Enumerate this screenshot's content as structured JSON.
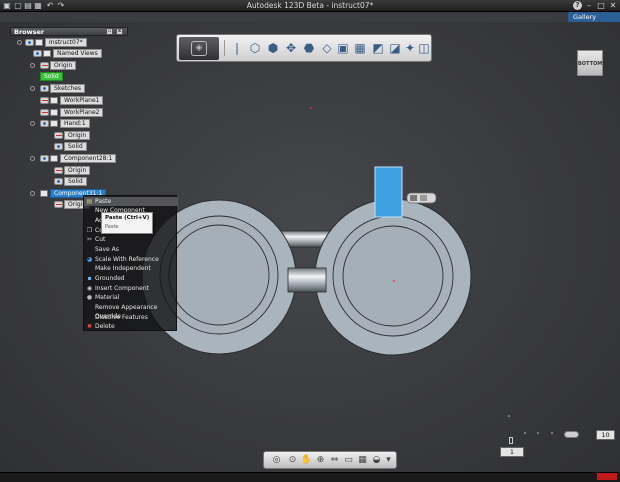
{
  "titlebar": {
    "title": "Autodesk 123D Beta - instruct07*",
    "help": "?",
    "gallery": "Gallery"
  },
  "browser": {
    "header": "Browser",
    "items": [
      {
        "label": "Instruct07*",
        "icon": "document-icon"
      },
      {
        "label": "Named Views",
        "icon": "folder-icon"
      },
      {
        "label": "Origin",
        "icon": "origin-icon"
      },
      {
        "label": "Solid",
        "icon": "solid-icon"
      },
      {
        "label": "Sketches",
        "icon": "folder-icon"
      },
      {
        "label": "WorkPlane1",
        "icon": "workplane-icon"
      },
      {
        "label": "WorkPlane2",
        "icon": "workplane-icon"
      },
      {
        "label": "Hand:1",
        "icon": "component-icon"
      },
      {
        "label": "Origin",
        "icon": "origin-icon"
      },
      {
        "label": "Solid",
        "icon": "solid-icon"
      },
      {
        "label": "Component28:1",
        "icon": "component-icon"
      },
      {
        "label": "Origin",
        "icon": "origin-icon"
      },
      {
        "label": "Solid",
        "icon": "solid-icon"
      },
      {
        "label": "Component31:1",
        "icon": "component-icon"
      },
      {
        "label": "Origin",
        "icon": "origin-icon"
      }
    ]
  },
  "viewcube": {
    "label": "BOTTOM"
  },
  "context_menu": {
    "items": [
      {
        "label": "Paste",
        "icon": "paste-icon"
      },
      {
        "label": "New Component",
        "icon": ""
      },
      {
        "label": "Activate",
        "icon": ""
      },
      {
        "label": "Copy",
        "icon": "copy-icon"
      },
      {
        "label": "Cut",
        "icon": "cut-icon"
      },
      {
        "label": "Save As",
        "icon": ""
      },
      {
        "label": "Scale With Reference",
        "icon": "scale-icon"
      },
      {
        "label": "Make Independent",
        "icon": ""
      },
      {
        "label": "Grounded",
        "icon": "grounded-icon"
      },
      {
        "label": "Insert Component",
        "icon": "insert-icon"
      },
      {
        "label": "Material",
        "icon": "material-icon"
      },
      {
        "label": "Remove Appearance Override",
        "icon": ""
      },
      {
        "label": "Dissolve Features",
        "icon": ""
      },
      {
        "label": "Delete",
        "icon": "delete-icon"
      }
    ],
    "submenu": {
      "title": "Paste (Ctrl+V)",
      "desc": "Paste"
    }
  },
  "bottom": {
    "grid_value": "1",
    "zoom_value": "10"
  },
  "colors": {
    "selection_blue": "#2b7fc9",
    "body_grey": "#a9b4bd",
    "cursor_box": "#3fa0e0",
    "status_red": "#c01a1a"
  }
}
